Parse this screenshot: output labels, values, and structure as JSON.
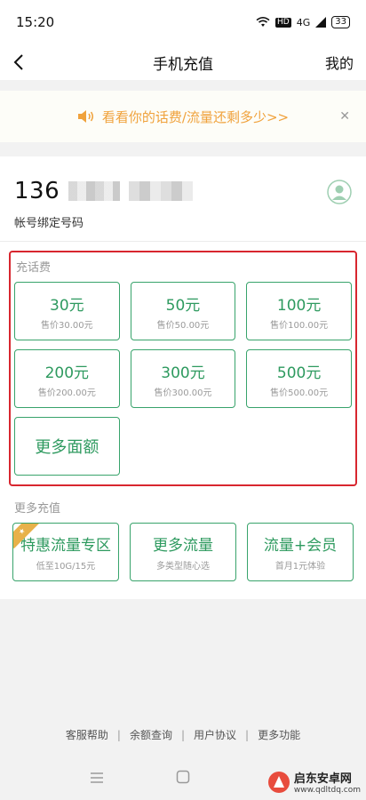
{
  "status_bar": {
    "time": "15:20",
    "network": "4G",
    "battery": "33"
  },
  "nav": {
    "title": "手机充值",
    "right_label": "我的"
  },
  "notice": {
    "text": "看看你的话费/流量还剩多少>>"
  },
  "account": {
    "number_prefix": "136",
    "label": "帐号绑定号码"
  },
  "recharge": {
    "section_title": "充话费",
    "tiles": [
      {
        "amount": "30元",
        "price": "售价30.00元"
      },
      {
        "amount": "50元",
        "price": "售价50.00元"
      },
      {
        "amount": "100元",
        "price": "售价100.00元"
      },
      {
        "amount": "200元",
        "price": "售价200.00元"
      },
      {
        "amount": "300元",
        "price": "售价300.00元"
      },
      {
        "amount": "500元",
        "price": "售价500.00元"
      }
    ],
    "more_label": "更多面额"
  },
  "more_recharge": {
    "section_title": "更多充值",
    "tiles": [
      {
        "title": "特惠流量专区",
        "subtitle": "低至10G/15元"
      },
      {
        "title": "更多流量",
        "subtitle": "多类型随心选"
      },
      {
        "title": "流量+会员",
        "subtitle": "首月1元体验"
      }
    ]
  },
  "footer": {
    "links": [
      "客服帮助",
      "余额查询",
      "用户协议",
      "更多功能"
    ]
  },
  "watermark": {
    "brand": "启东安卓网",
    "url": "www.qdltdq.com"
  },
  "colors": {
    "accent_green": "#2e9a5f",
    "highlight_red": "#d8262f",
    "notice_orange": "#f0a23c"
  }
}
